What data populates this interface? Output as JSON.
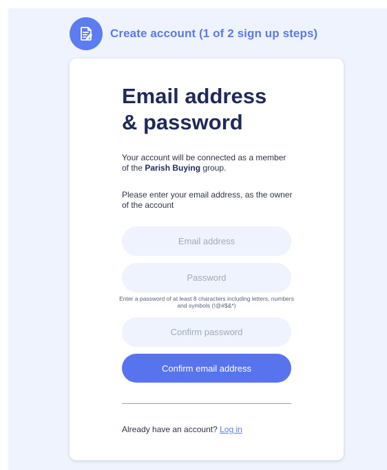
{
  "header": {
    "icon": "document-edit-icon",
    "title": "Create account (1 of 2 sign up steps)"
  },
  "card": {
    "heading_line1": "Email address",
    "heading_line2": "& password",
    "intro_prefix": "Your account will be connected as a member of the ",
    "group_name": "Parish Buying",
    "intro_suffix": " group.",
    "instruction": "Please enter your email address, as the owner of the account"
  },
  "form": {
    "email": {
      "placeholder": "Email address",
      "value": ""
    },
    "password": {
      "placeholder": "Password",
      "value": ""
    },
    "password_hint": "Enter a password of at least 8 characters including letters, numbers and symbols (!@#$&*)",
    "confirm_password": {
      "placeholder": "Confirm password",
      "value": ""
    },
    "submit_label": "Confirm email address"
  },
  "footer": {
    "prompt": "Already have an account?",
    "login_label": "Log in"
  },
  "colors": {
    "brand": "#5a79ef",
    "button": "#5774ee",
    "heading": "#1f2a5a",
    "field_bg": "#eef3fd",
    "page_bg": "#eef3fd"
  }
}
